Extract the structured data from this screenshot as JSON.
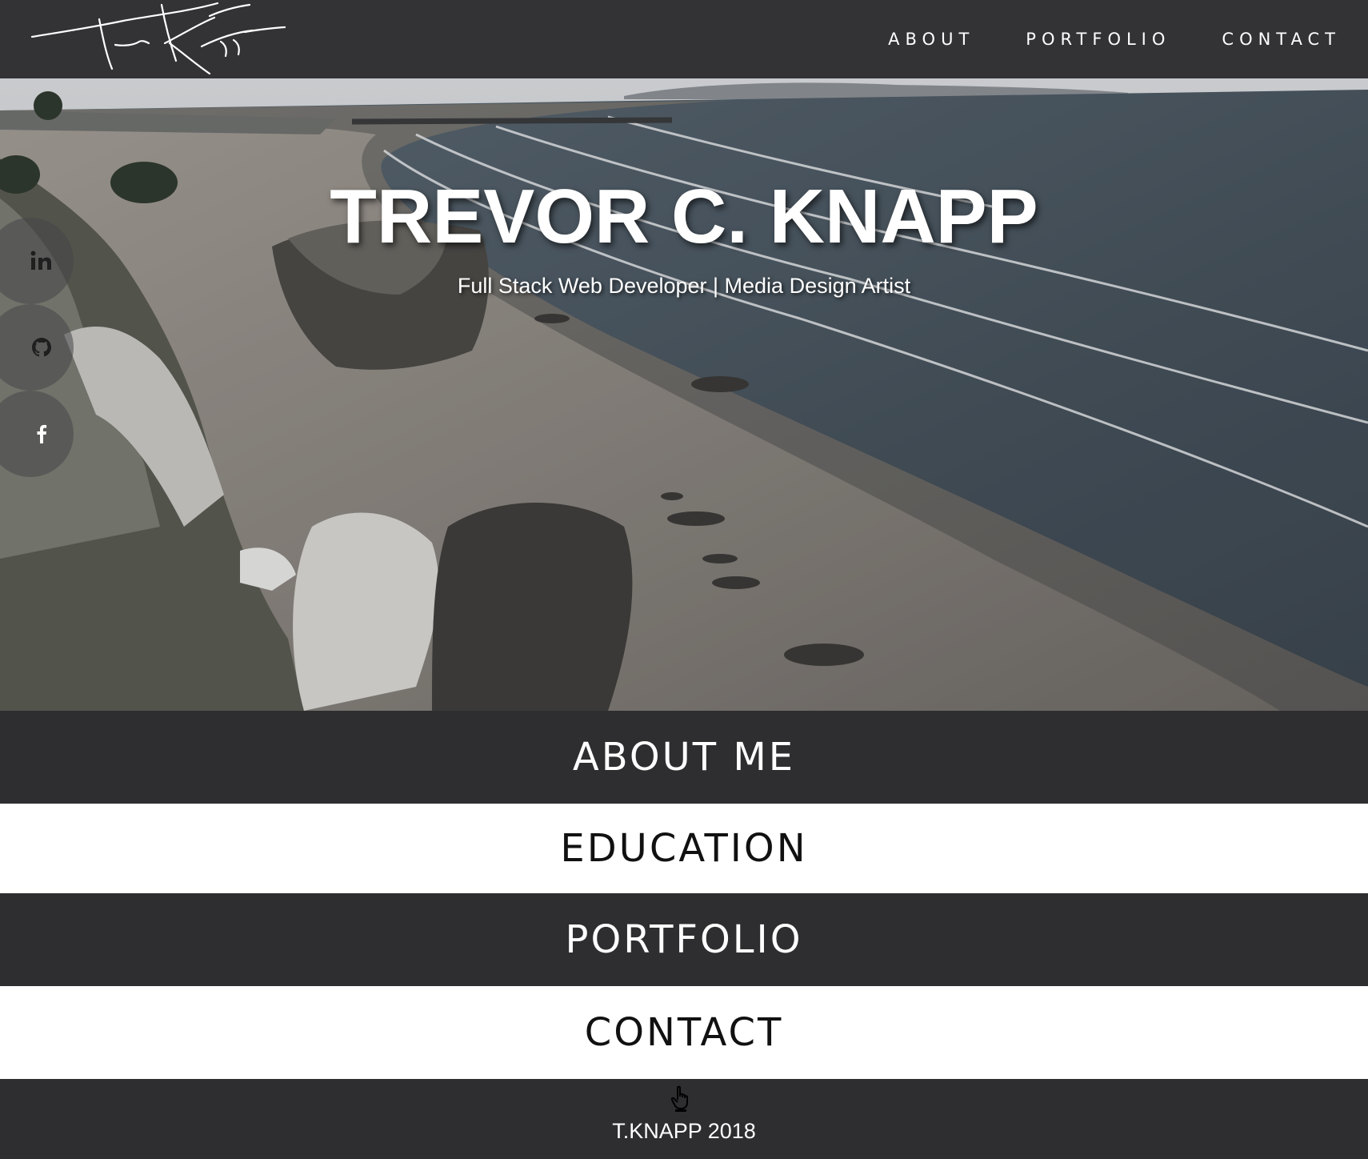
{
  "nav": {
    "logo_icon": "signature-logo",
    "links": [
      "ABOUT",
      "PORTFOLIO",
      "CONTACT"
    ]
  },
  "hero": {
    "title": "TREVOR C. KNAPP",
    "subtitle": "Full Stack Web Developer | Media Design Artist"
  },
  "social": {
    "icons": [
      "linkedin-icon",
      "github-icon",
      "facebook-icon"
    ]
  },
  "sections": [
    {
      "label": "ABOUT ME",
      "theme": "dark"
    },
    {
      "label": "EDUCATION",
      "theme": "light"
    },
    {
      "label": "PORTFOLIO",
      "theme": "dark"
    },
    {
      "label": "CONTACT",
      "theme": "light"
    }
  ],
  "footer": {
    "icon": "pointing-hand-icon",
    "text": "T.KNAPP 2018"
  },
  "colors": {
    "dark": "#2e2e30",
    "navbar": "#333336",
    "light": "#ffffff"
  }
}
